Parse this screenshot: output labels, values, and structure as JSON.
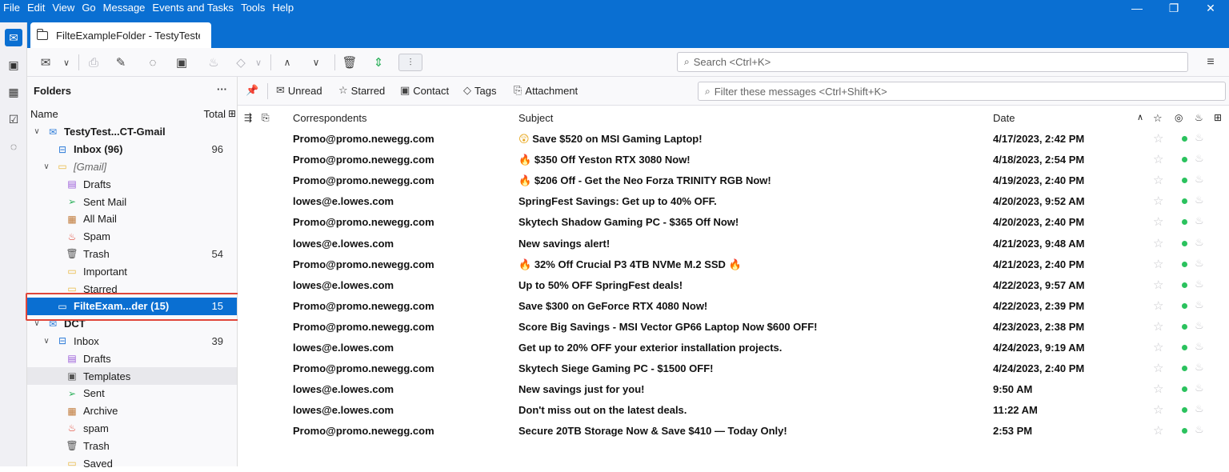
{
  "menu": [
    "File",
    "Edit",
    "View",
    "Go",
    "Message",
    "Events and Tasks",
    "Tools",
    "Help"
  ],
  "window_controls": {
    "minimize": "—",
    "restore": "❐",
    "close": "✕"
  },
  "tab": {
    "title": "FilteExampleFolder - TestyTeste"
  },
  "search": {
    "placeholder": "Search <Ctrl+K>"
  },
  "folder_pane": {
    "title": "Folders",
    "more": "···",
    "col_name": "Name",
    "col_total": "Total",
    "folders": [
      {
        "name": "TestyTest...CT-Gmail",
        "count": "",
        "icon": "account-icon",
        "bold": true
      },
      {
        "name": "Inbox (96)",
        "count": "96",
        "icon": "inbox-icon",
        "bold": true
      },
      {
        "name": "[Gmail]",
        "count": "",
        "icon": "folder-icon",
        "italic": true
      },
      {
        "name": "Drafts",
        "count": "",
        "icon": "drafts-icon"
      },
      {
        "name": "Sent Mail",
        "count": "",
        "icon": "sent-icon"
      },
      {
        "name": "All Mail",
        "count": "",
        "icon": "archive-icon"
      },
      {
        "name": "Spam",
        "count": "",
        "icon": "spam-icon"
      },
      {
        "name": "Trash",
        "count": "54",
        "icon": "trash-icon"
      },
      {
        "name": "Important",
        "count": "",
        "icon": "folder-icon"
      },
      {
        "name": "Starred",
        "count": "",
        "icon": "folder-icon"
      },
      {
        "name": "FilteExam...der (15)",
        "count": "15",
        "icon": "folder-icon",
        "bold": true,
        "selected": true
      },
      {
        "name": "DCT",
        "count": "",
        "icon": "account-icon",
        "bold": true
      },
      {
        "name": "Inbox",
        "count": "39",
        "icon": "inbox-icon"
      },
      {
        "name": "Drafts",
        "count": "",
        "icon": "drafts-icon"
      },
      {
        "name": "Templates",
        "count": "",
        "icon": "templates-icon"
      },
      {
        "name": "Sent",
        "count": "",
        "icon": "sent-icon"
      },
      {
        "name": "Archive",
        "count": "",
        "icon": "archive-icon"
      },
      {
        "name": "spam",
        "count": "",
        "icon": "spam-icon"
      },
      {
        "name": "Trash",
        "count": "",
        "icon": "trash-icon"
      },
      {
        "name": "Saved",
        "count": "",
        "icon": "folder-icon"
      }
    ]
  },
  "quick_filter": {
    "unread": "Unread",
    "starred": "Starred",
    "contact": "Contact",
    "tags": "Tags",
    "attachment": "Attachment",
    "filter_placeholder": "Filter these messages <Ctrl+Shift+K>"
  },
  "thread_columns": {
    "correspondents": "Correspondents",
    "subject": "Subject",
    "date": "Date"
  },
  "messages": [
    {
      "from": "Promo@promo.newegg.com",
      "emoji": "😲",
      "subject": "Save $520 on MSI Gaming Laptop!",
      "date": "4/17/2023, 2:42 PM"
    },
    {
      "from": "Promo@promo.newegg.com",
      "emoji": "🔥",
      "subject": "$350 Off Yeston RTX 3080 Now!",
      "date": "4/18/2023, 2:54 PM"
    },
    {
      "from": "Promo@promo.newegg.com",
      "emoji": "🔥",
      "subject": "$206 Off - Get the Neo Forza TRINITY RGB Now!",
      "date": "4/19/2023, 2:40 PM"
    },
    {
      "from": "lowes@e.lowes.com",
      "emoji": "",
      "subject": "SpringFest Savings: Get up to 40% OFF.",
      "date": "4/20/2023, 9:52 AM"
    },
    {
      "from": "Promo@promo.newegg.com",
      "emoji": "",
      "subject": "Skytech Shadow Gaming PC - $365 Off Now!",
      "date": "4/20/2023, 2:40 PM"
    },
    {
      "from": "lowes@e.lowes.com",
      "emoji": "",
      "subject": "New savings alert!",
      "date": "4/21/2023, 9:48 AM"
    },
    {
      "from": "Promo@promo.newegg.com",
      "emoji": "🔥",
      "subject": " 32% Off Crucial P3 4TB NVMe M.2 SSD 🔥",
      "date": "4/21/2023, 2:40 PM"
    },
    {
      "from": "lowes@e.lowes.com",
      "emoji": "",
      "subject": "Up to 50% OFF SpringFest deals!",
      "date": "4/22/2023, 9:57 AM"
    },
    {
      "from": "Promo@promo.newegg.com",
      "emoji": "",
      "subject": "Save $300 on GeForce RTX 4080 Now!",
      "date": "4/22/2023, 2:39 PM"
    },
    {
      "from": "Promo@promo.newegg.com",
      "emoji": "",
      "subject": "Score Big Savings - MSI Vector GP66 Laptop Now $600 OFF!",
      "date": "4/23/2023, 2:38 PM"
    },
    {
      "from": "lowes@e.lowes.com",
      "emoji": "",
      "subject": "Get up to 20% OFF your exterior installation projects.",
      "date": "4/24/2023, 9:19 AM"
    },
    {
      "from": "Promo@promo.newegg.com",
      "emoji": "",
      "subject": "Skytech Siege Gaming PC - $1500 OFF!",
      "date": "4/24/2023, 2:40 PM"
    },
    {
      "from": "lowes@e.lowes.com",
      "emoji": "",
      "subject": "New savings just for you!",
      "date": "9:50 AM"
    },
    {
      "from": "lowes@e.lowes.com",
      "emoji": "",
      "subject": "Don't miss out on the latest deals.",
      "date": "11:22 AM"
    },
    {
      "from": "Promo@promo.newegg.com",
      "emoji": "",
      "subject": "Secure 20TB Storage Now & Save $410 — Today Only!",
      "date": "2:53 PM"
    }
  ],
  "colors": {
    "accent": "#0a6fd2",
    "unread_dot": "#2bc25e",
    "selection_outline": "#e0463a"
  }
}
